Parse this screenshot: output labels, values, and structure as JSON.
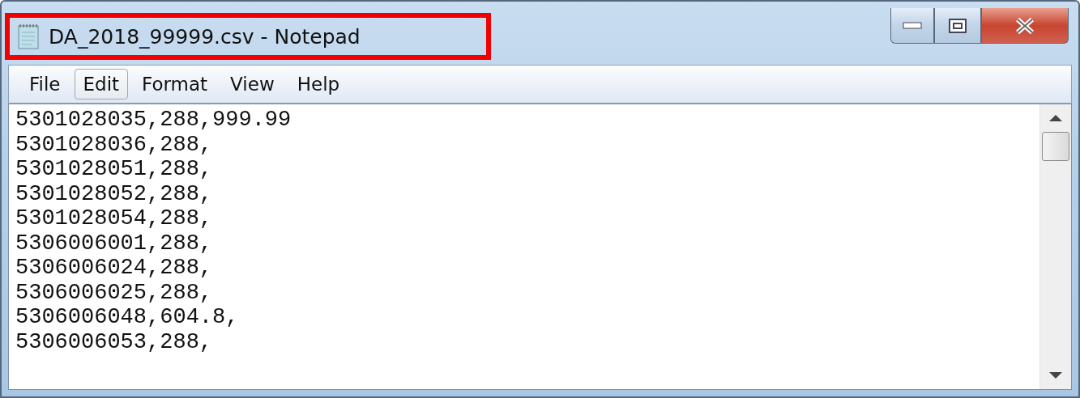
{
  "window": {
    "title": "DA_2018_99999.csv - Notepad",
    "title_highlighted": true
  },
  "menu": [
    {
      "label": "File",
      "selected": false
    },
    {
      "label": "Edit",
      "selected": true
    },
    {
      "label": "Format",
      "selected": false
    },
    {
      "label": "View",
      "selected": false
    },
    {
      "label": "Help",
      "selected": false
    }
  ],
  "editor": {
    "lines": [
      "5301028035,288,999.99",
      "5301028036,288,",
      "5301028051,288,",
      "5301028052,288,",
      "5301028054,288,",
      "5306006001,288,",
      "5306006024,288,",
      "5306006025,288,",
      "5306006048,604.8,",
      "5306006053,288,"
    ]
  }
}
